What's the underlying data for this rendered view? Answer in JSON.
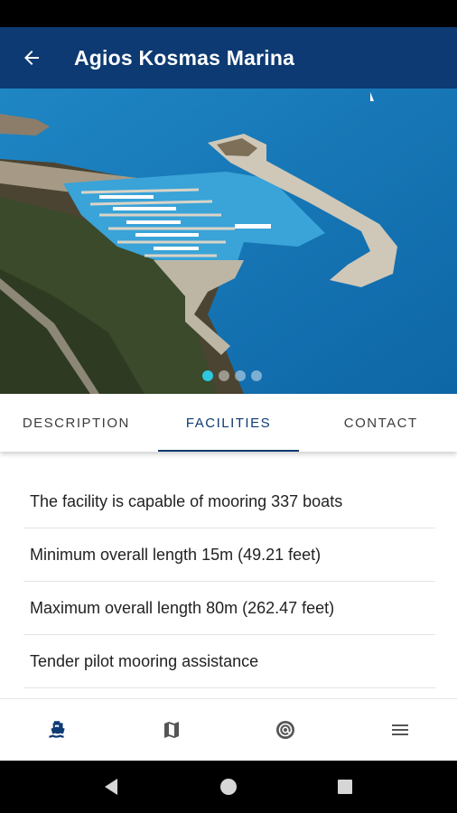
{
  "app_bar": {
    "title": "Agios Kosmas Marina",
    "back_icon": "arrow-left-icon",
    "background": "#0d3a72"
  },
  "hero": {
    "image_desc_icon": "marina-aerial-photo",
    "carousel": {
      "count": 4,
      "active_index": 0,
      "active_color": "#2ec6e0"
    }
  },
  "tabs": [
    {
      "label": "DESCRIPTION",
      "active": false
    },
    {
      "label": "FACILITIES",
      "active": true
    },
    {
      "label": "CONTACT",
      "active": false
    }
  ],
  "facilities": [
    "The facility is capable of mooring 337 boats",
    "Minimum overall length 15m (49.21 feet)",
    "Maximum overall length 80m (262.47 feet)",
    "Tender pilot mooring assistance"
  ],
  "bottom_nav": [
    {
      "icon": "boat-icon",
      "active": true
    },
    {
      "icon": "map-icon",
      "active": false
    },
    {
      "icon": "at-sign-icon",
      "active": false
    },
    {
      "icon": "menu-icon",
      "active": false
    }
  ],
  "system_nav": [
    "back-triangle-icon",
    "home-circle-icon",
    "recents-square-icon"
  ]
}
